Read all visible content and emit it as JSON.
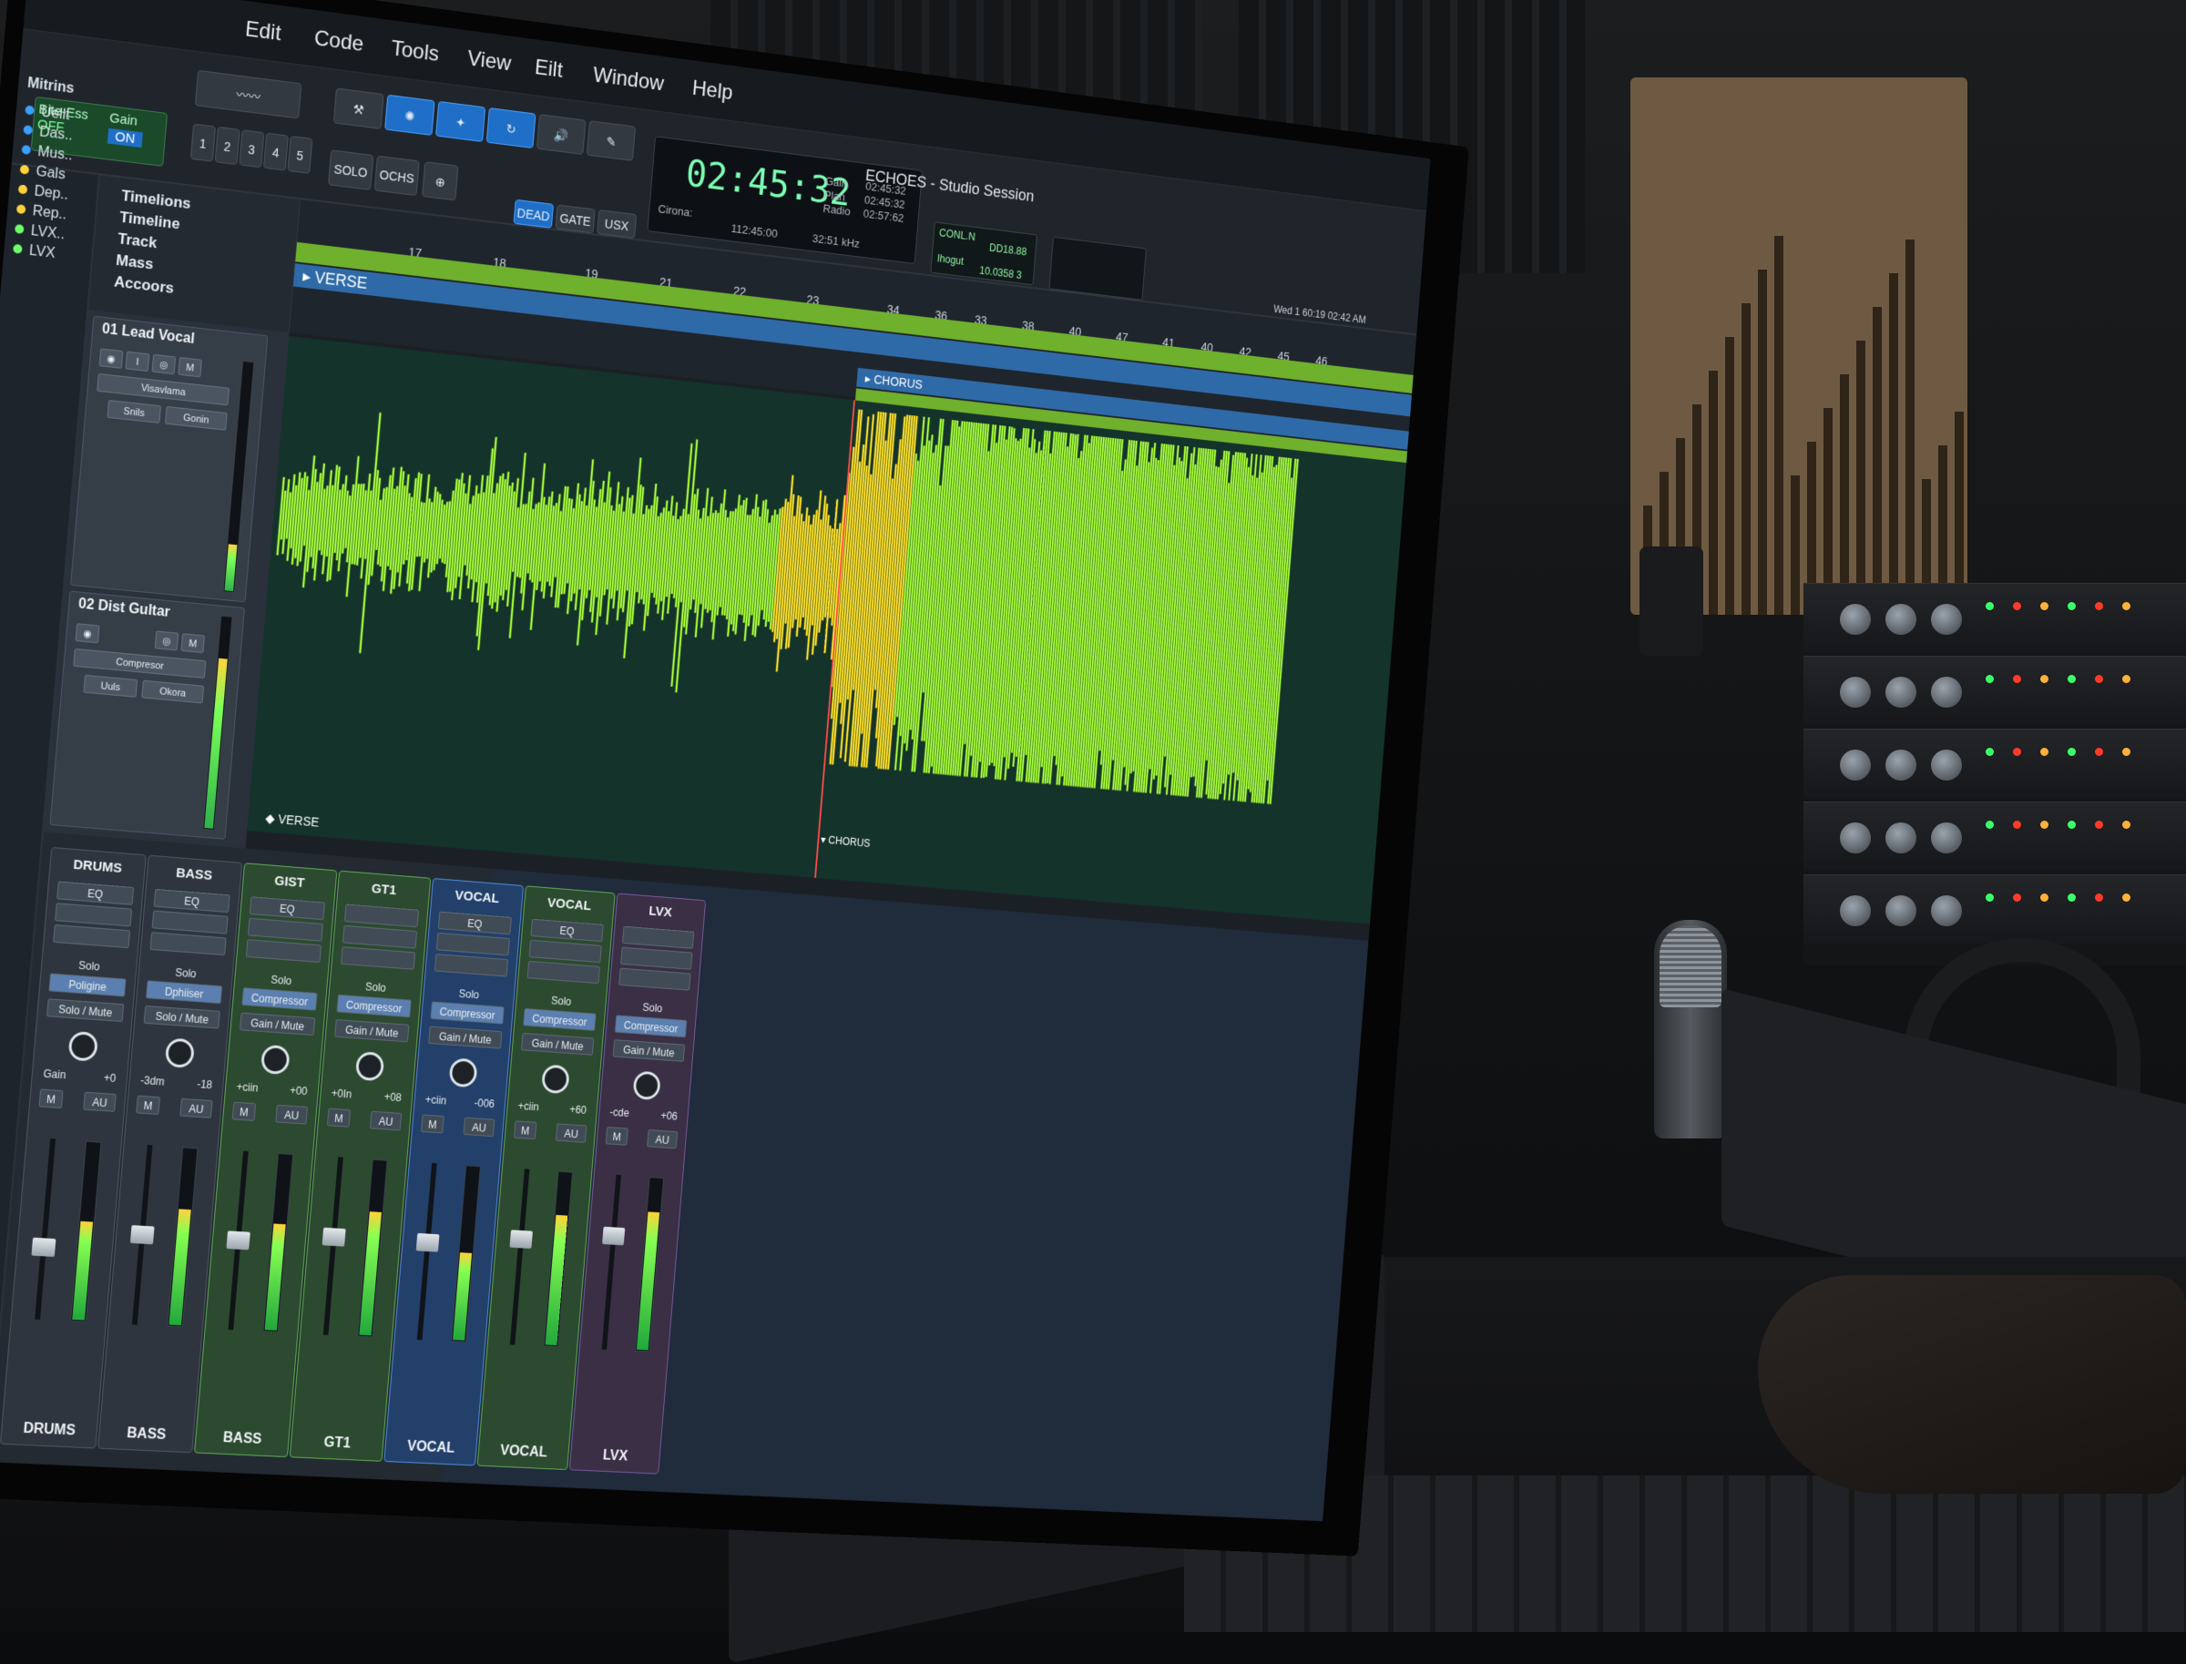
{
  "menubar": {
    "items": [
      "Edit",
      "Code",
      "Tools",
      "View",
      "Eilt",
      "Window",
      "Help"
    ]
  },
  "status_left": {
    "label1": "Bite-Ess",
    "value1": "OFF",
    "label2": "Gain",
    "value2": "ON"
  },
  "toolbar": {
    "numbers": [
      "1",
      "2",
      "3",
      "4",
      "5"
    ],
    "solo": "SOLO",
    "ochs": "OCHS",
    "dead": "DEAD",
    "gate": "GATE",
    "usx": "USX"
  },
  "transport": {
    "time": "02:45:32",
    "clock_label": "Cirona:",
    "clock_sub": "112:45:00",
    "gain_label": "Gain",
    "plan_label": "Plan",
    "radio_label": "Radio",
    "gain_val": "02:45:32",
    "plan_val": "02:45:32",
    "radio_val": "02:57:62",
    "rate": "32:51 kHz"
  },
  "session_title": "ECHOES - Studio Session",
  "sync": {
    "a": "CONL.N",
    "b": "DD18.88",
    "c": "Ihogut",
    "d": "10.0358 3"
  },
  "systray": {
    "time": "Wed 1 60:19 02:42 AM"
  },
  "sidebar": {
    "title": "Mitrins",
    "items": [
      {
        "label": "Uellt",
        "color": "#3aa0ff"
      },
      {
        "label": "Das..",
        "color": "#3aa0ff"
      },
      {
        "label": "Mus..",
        "color": "#3aa0ff"
      },
      {
        "label": "Gals",
        "color": "#ffd23a"
      },
      {
        "label": "Dep..",
        "color": "#ffd23a"
      },
      {
        "label": "Rep..",
        "color": "#ffd23a"
      },
      {
        "label": "LVX..",
        "color": "#6fff6a"
      },
      {
        "label": "LVX",
        "color": "#6fff6a"
      }
    ]
  },
  "ruler_head": {
    "rows": [
      "Timelions",
      "Timeline",
      "Track",
      "Mass",
      "Accoors"
    ]
  },
  "ruler": {
    "ticks": [
      "17",
      "18",
      "19",
      "21",
      "22",
      "23",
      "34",
      "36",
      "33",
      "38",
      "40",
      "47",
      "41",
      "40",
      "42",
      "45",
      "46"
    ],
    "verse": "VERSE",
    "chorus": "CHORUS"
  },
  "tracks": [
    {
      "name": "01 Lead Vocal",
      "plugin": "Visavlama",
      "b1": "Snils",
      "b2": "Gonin"
    },
    {
      "name": "02 Dist Gultar",
      "plugin": "Compresor",
      "b1": "Uuls",
      "b2": "Okora"
    },
    {
      "name": "01 Lead Vocal"
    }
  ],
  "wave_labels": {
    "verse": "VERSE",
    "chorus": "CHORUS"
  },
  "mixer": {
    "strips": [
      {
        "top": "DRUMS",
        "eq": "EQ",
        "solo": "Solo",
        "ins": "Poligine",
        "gm": "Solo / Mute",
        "gain": "Gain",
        "gainval": "+0",
        "foot": "DRUMS",
        "color": "gray",
        "level": 0.55,
        "fader": 0.45
      },
      {
        "top": "BASS",
        "eq": "EQ",
        "solo": "Solo",
        "ins": "Dphiiser",
        "gm": "Solo / Mute",
        "gain": "-3dm",
        "gainval": "-18",
        "foot": "BASS",
        "color": "gray",
        "level": 0.65,
        "fader": 0.55
      },
      {
        "top": "GIST",
        "eq": "EQ",
        "solo": "Solo",
        "ins": "Compressor",
        "gm": "Gain / Mute",
        "gain": "+ciin",
        "gainval": "+00",
        "foot": "BASS",
        "color": "green",
        "level": 0.6,
        "fader": 0.55
      },
      {
        "top": "GT1",
        "eq": "",
        "solo": "Solo",
        "ins": "Compressor",
        "gm": "Gain / Mute",
        "gain": "+0In",
        "gainval": "+08",
        "foot": "GT1",
        "color": "green",
        "level": 0.7,
        "fader": 0.6
      },
      {
        "top": "VOCAL",
        "eq": "EQ",
        "solo": "Solo",
        "ins": "Compressor",
        "gm": "Gain / Mute",
        "gain": "+ciin",
        "gainval": "-006",
        "foot": "VOCAL",
        "color": "blue",
        "level": 0.5,
        "fader": 0.6
      },
      {
        "top": "VOCAL",
        "eq": "EQ",
        "solo": "Solo",
        "ins": "Compressor",
        "gm": "Gain / Mute",
        "gain": "+ciin",
        "gainval": "+60",
        "foot": "VOCAL",
        "color": "green",
        "level": 0.75,
        "fader": 0.65
      },
      {
        "top": "LVX",
        "eq": "",
        "solo": "Solo",
        "ins": "Compressor",
        "gm": "Gain / Mute",
        "gain": "-cde",
        "gainval": "+06",
        "foot": "LVX",
        "color": "purple",
        "level": 0.8,
        "fader": 0.7
      }
    ]
  },
  "colors": {
    "accent": "#1f6fc8",
    "wave_green": "#a8ff3a",
    "wave_yellow": "#ffe12a",
    "wave_red": "#ff3a2a",
    "bar_green": "#6fb02d",
    "bar_blue": "#2f6aa8"
  }
}
